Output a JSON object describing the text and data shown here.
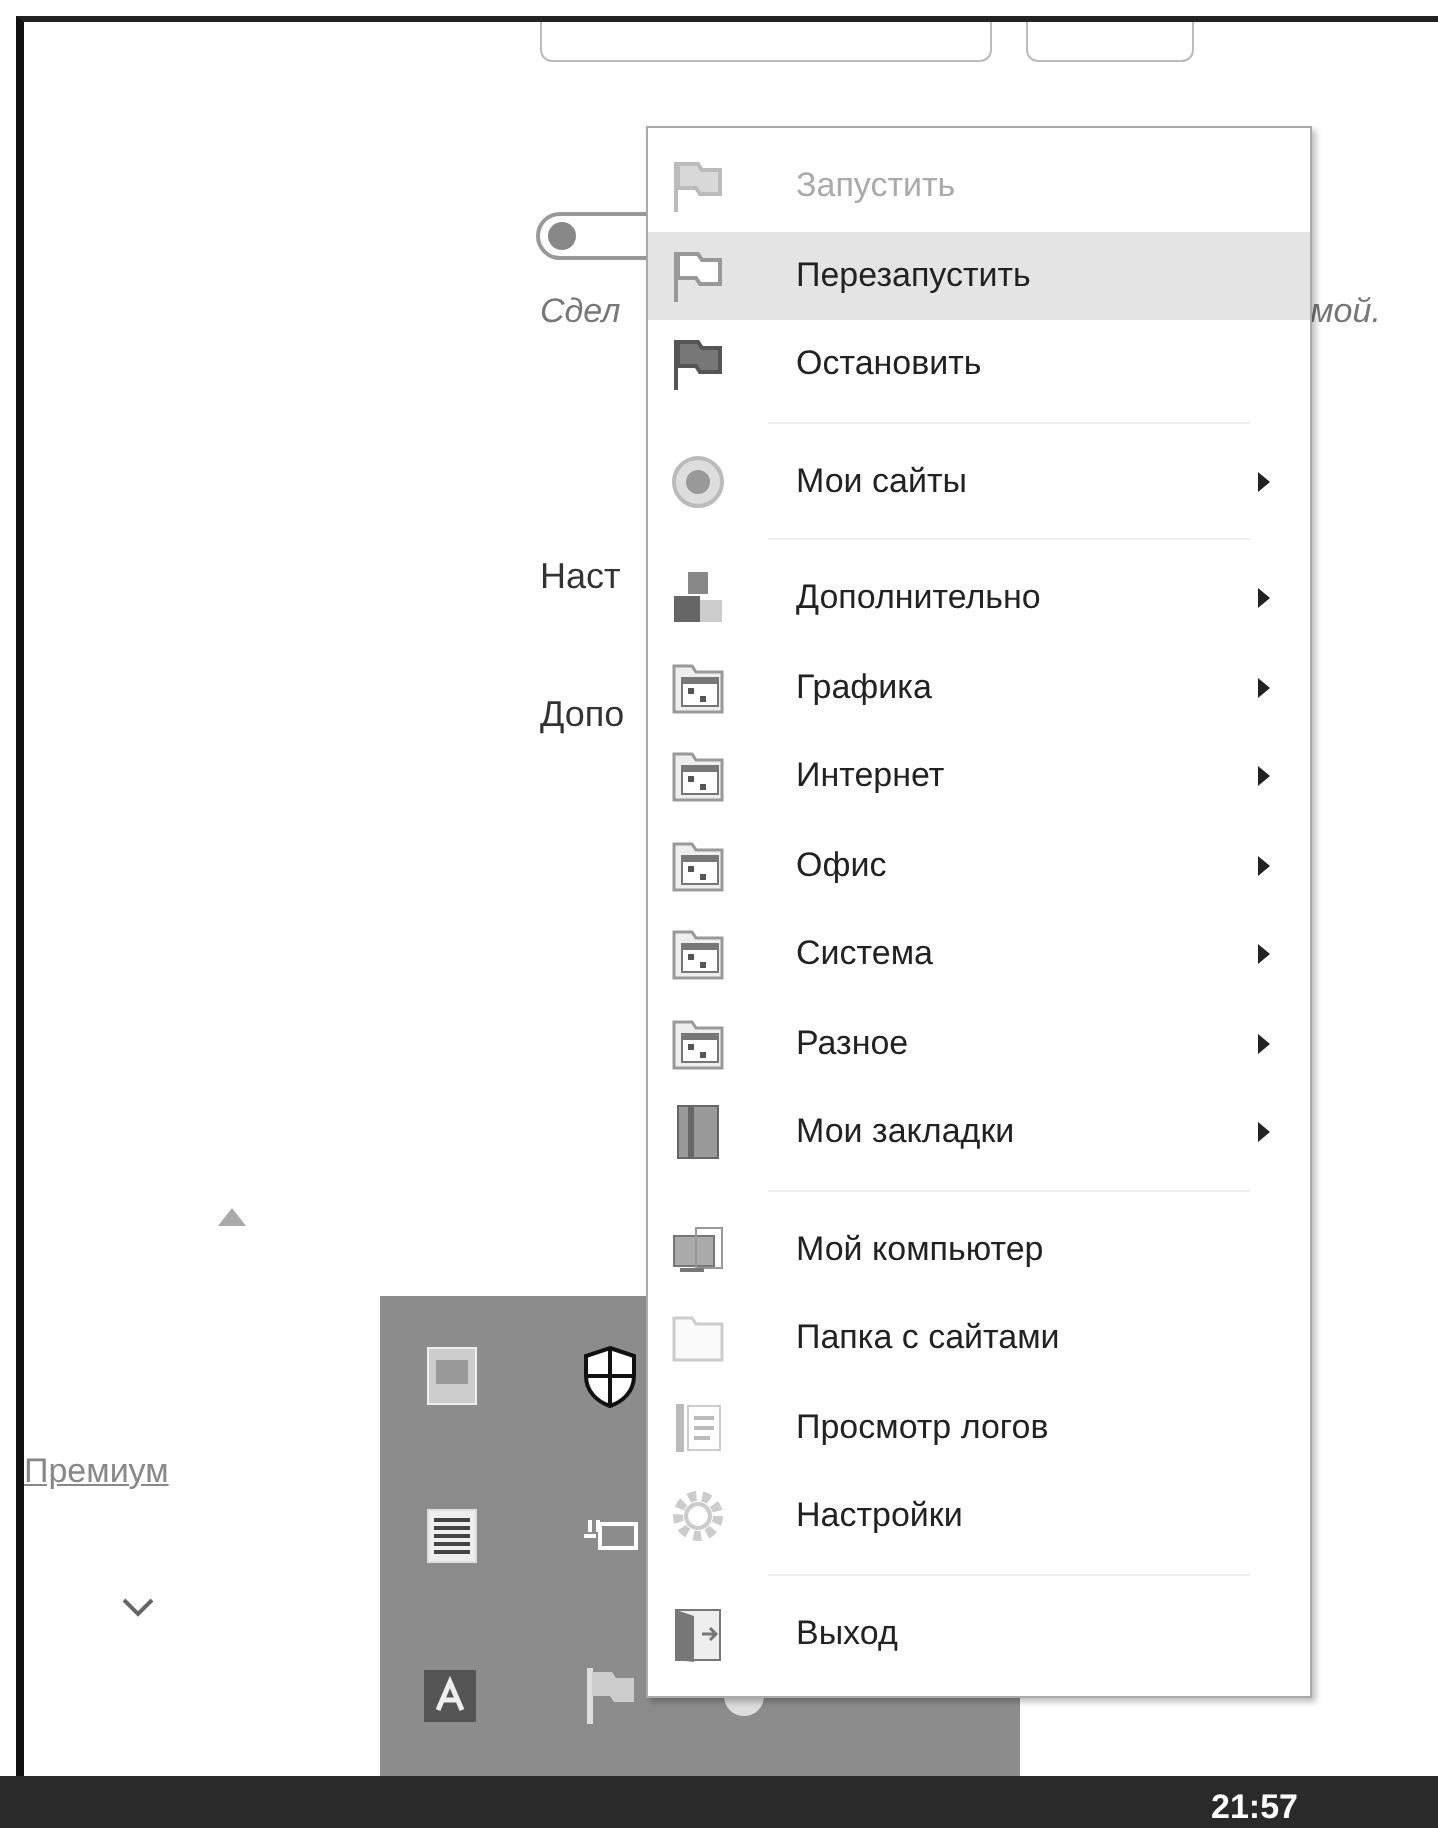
{
  "background": {
    "toggle": {
      "on": false
    },
    "note_start": "Сдел",
    "note_end": "мой.",
    "labels": [
      "Наст",
      "Допо"
    ],
    "link": "Премиум"
  },
  "context_menu": {
    "items": [
      {
        "kind": "item",
        "label": "Запустить",
        "disabled": true,
        "selected": false,
        "submenu": false
      },
      {
        "kind": "item",
        "label": "Перезапустить",
        "disabled": false,
        "selected": true,
        "submenu": false
      },
      {
        "kind": "item",
        "label": "Остановить",
        "disabled": false,
        "selected": false,
        "submenu": false
      },
      {
        "kind": "separator"
      },
      {
        "kind": "item",
        "label": "Мои сайты",
        "disabled": false,
        "selected": false,
        "submenu": true
      },
      {
        "kind": "separator"
      },
      {
        "kind": "item",
        "label": "Дополнительно",
        "disabled": false,
        "selected": false,
        "submenu": true
      },
      {
        "kind": "item",
        "label": "Графика",
        "disabled": false,
        "selected": false,
        "submenu": true
      },
      {
        "kind": "item",
        "label": "Интернет",
        "disabled": false,
        "selected": false,
        "submenu": true
      },
      {
        "kind": "item",
        "label": "Офис",
        "disabled": false,
        "selected": false,
        "submenu": true
      },
      {
        "kind": "item",
        "label": "Система",
        "disabled": false,
        "selected": false,
        "submenu": true
      },
      {
        "kind": "item",
        "label": "Разное",
        "disabled": false,
        "selected": false,
        "submenu": true
      },
      {
        "kind": "item",
        "label": "Мои закладки",
        "disabled": false,
        "selected": false,
        "submenu": true
      },
      {
        "kind": "separator"
      },
      {
        "kind": "item",
        "label": "Мой компьютер",
        "disabled": false,
        "selected": false,
        "submenu": false
      },
      {
        "kind": "item",
        "label": "Папка с сайтами",
        "disabled": false,
        "selected": false,
        "submenu": false
      },
      {
        "kind": "item",
        "label": "Просмотр логов",
        "disabled": false,
        "selected": false,
        "submenu": false
      },
      {
        "kind": "item",
        "label": "Настройки",
        "disabled": false,
        "selected": false,
        "submenu": false
      },
      {
        "kind": "separator"
      },
      {
        "kind": "item",
        "label": "Выход",
        "disabled": false,
        "selected": false,
        "submenu": false
      }
    ]
  },
  "taskbar": {
    "clock": "21:57"
  }
}
